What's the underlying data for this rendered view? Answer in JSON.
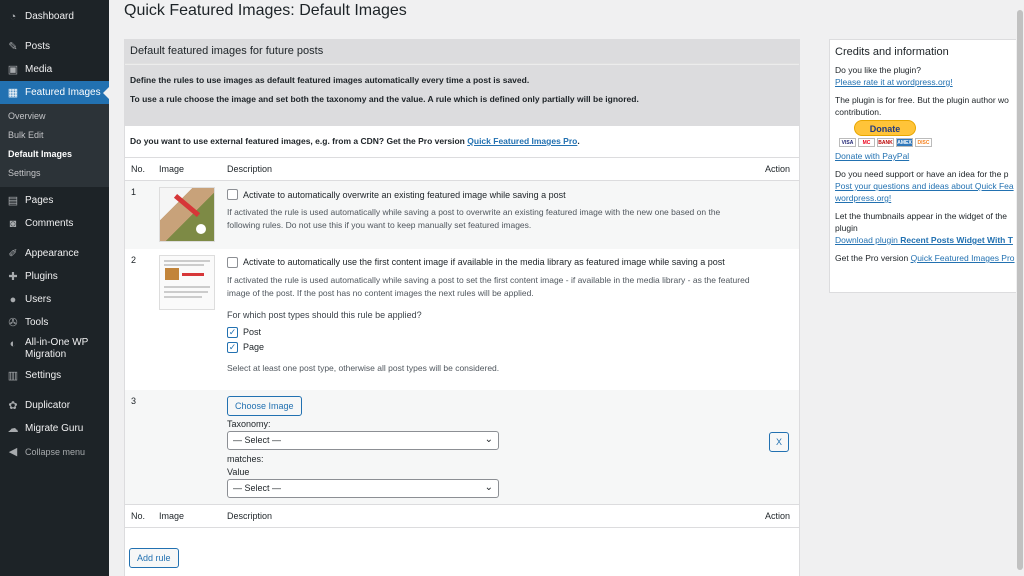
{
  "sidebar": {
    "items": [
      {
        "label": "Dashboard",
        "icon": "dashboard-icon"
      },
      {
        "label": "Posts",
        "icon": "pin-icon"
      },
      {
        "label": "Media",
        "icon": "media-icon"
      },
      {
        "label": "Featured Images",
        "icon": "image-icon"
      },
      {
        "label": "Pages",
        "icon": "page-icon"
      },
      {
        "label": "Comments",
        "icon": "comment-icon"
      },
      {
        "label": "Appearance",
        "icon": "brush-icon"
      },
      {
        "label": "Plugins",
        "icon": "plug-icon"
      },
      {
        "label": "Users",
        "icon": "user-icon"
      },
      {
        "label": "Tools",
        "icon": "wrench-icon"
      },
      {
        "label": "All-in-One WP Migration",
        "icon": "migration-icon"
      },
      {
        "label": "Settings",
        "icon": "settings-icon"
      },
      {
        "label": "Duplicator",
        "icon": "duplicator-icon"
      },
      {
        "label": "Migrate Guru",
        "icon": "cloud-icon"
      },
      {
        "label": "Collapse menu",
        "icon": "collapse-icon"
      }
    ],
    "submenu": [
      "Overview",
      "Bulk Edit",
      "Default Images",
      "Settings"
    ]
  },
  "page_title": "Quick Featured Images: Default Images",
  "main": {
    "heading": "Default featured images for future posts",
    "intro1": "Define the rules to use images as default featured images automatically every time a post is saved.",
    "intro2": "To use a rule choose the image and set both the taxonomy and the value. A rule which is defined only partially will be ignored.",
    "pro_text": "Do you want to use external featured images, e.g. from a CDN? Get the Pro version",
    "pro_link": "Quick Featured Images Pro",
    "pro_dot": ".",
    "columns": {
      "no": "No.",
      "image": "Image",
      "description": "Description",
      "action": "Action"
    },
    "rule1": {
      "no": "1",
      "checkbox": "Activate to automatically overwrite an existing featured image while saving a post",
      "help": "If activated the rule is used automatically while saving a post to overwrite an existing featured image with the new one based on the following rules. Do not use this if you want to keep manually set featured images."
    },
    "rule2": {
      "no": "2",
      "checkbox": "Activate to automatically use the first content image if available in the media library as featured image while saving a post",
      "help": "If activated the rule is used automatically while saving a post to set the first content image - if available in the media library - as the featured image of the post. If the post has no content images the next rules will be applied.",
      "question": "For which post types should this rule be applied?",
      "types": [
        "Post",
        "Page"
      ],
      "note": "Select at least one post type, otherwise all post types will be considered."
    },
    "rule3": {
      "no": "3",
      "choose_button": "Choose Image",
      "taxonomy_label": "Taxonomy:",
      "taxonomy_value": "— Select —",
      "matches": "matches:",
      "value_label": "Value",
      "value_value": "— Select —",
      "remove": "X"
    },
    "add_rule": "Add rule"
  },
  "credits": {
    "title": "Credits and information",
    "like": "Do you like the plugin?",
    "rate": "Please rate it at wordpress.org!",
    "free1": "The plugin is for free. But the plugin author wo",
    "free2": "contribution.",
    "donate_btn": "Donate",
    "donate_link": "Donate with PayPal",
    "support": "Do you need support or have an idea for the p",
    "post_link1": "Post your questions and ideas about Quick Fea",
    "post_link2": "wordpress.org!",
    "thumbs1": "Let the thumbnails appear in the widget of the",
    "thumbs2": "plugin",
    "download_pre": "Download plugin ",
    "download_bold": "Recent Posts Widget With T",
    "pro_pre": "Get the Pro version ",
    "pro_link": "Quick Featured Images Pro",
    "cards": [
      "VISA",
      "MC",
      "AMEX",
      "BANK",
      "DISC"
    ]
  }
}
